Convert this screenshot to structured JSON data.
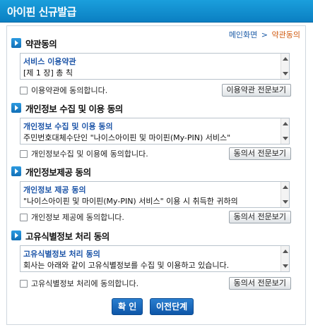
{
  "header": {
    "title": "아이핀 신규발급"
  },
  "breadcrumb": {
    "home": "메인화면",
    "separator": ">",
    "current": "약관동의"
  },
  "sections": [
    {
      "title": "약관동의",
      "box_title": "서비스 이용약관",
      "box_body": "[제 1 장] 총 칙",
      "agree_label": "이용약관에 동의합니다.",
      "view_button": "이용약관 전문보기"
    },
    {
      "title": "개인정보 수집 및 이용 동의",
      "box_title": "개인정보 수집 및 이용 동의",
      "box_body": "주민번호대체수단인 \"나이스아이핀 및 마이핀(My-PIN) 서비스\"",
      "agree_label": "개인정보수집 및 이용에 동의합니다.",
      "view_button": "동의서 전문보기"
    },
    {
      "title": "개인정보제공 동의",
      "box_title": "개인정보 제공 동의",
      "box_body": "\"나이스아이핀 및 마이핀(My-PIN) 서비스\" 이용 시 취득한 귀하의",
      "agree_label": "개인정보 제공에 동의합니다.",
      "view_button": "동의서 전문보기"
    },
    {
      "title": "고유식별정보 처리 동의",
      "box_title": "고유식별정보 처리 동의",
      "box_body": "회사는 아래와 같이 고유식별정보를 수집 및 이용하고 있습니다.",
      "agree_label": "고유식별정보 처리에 동의합니다.",
      "view_button": "동의서 전문보기"
    }
  ],
  "buttons": {
    "confirm": "확 인",
    "previous": "이전단계"
  },
  "colors": {
    "header_bg": "#118fd2",
    "link": "#1a5aa6",
    "current": "#d05a10",
    "button_bg": "#1565b9"
  }
}
